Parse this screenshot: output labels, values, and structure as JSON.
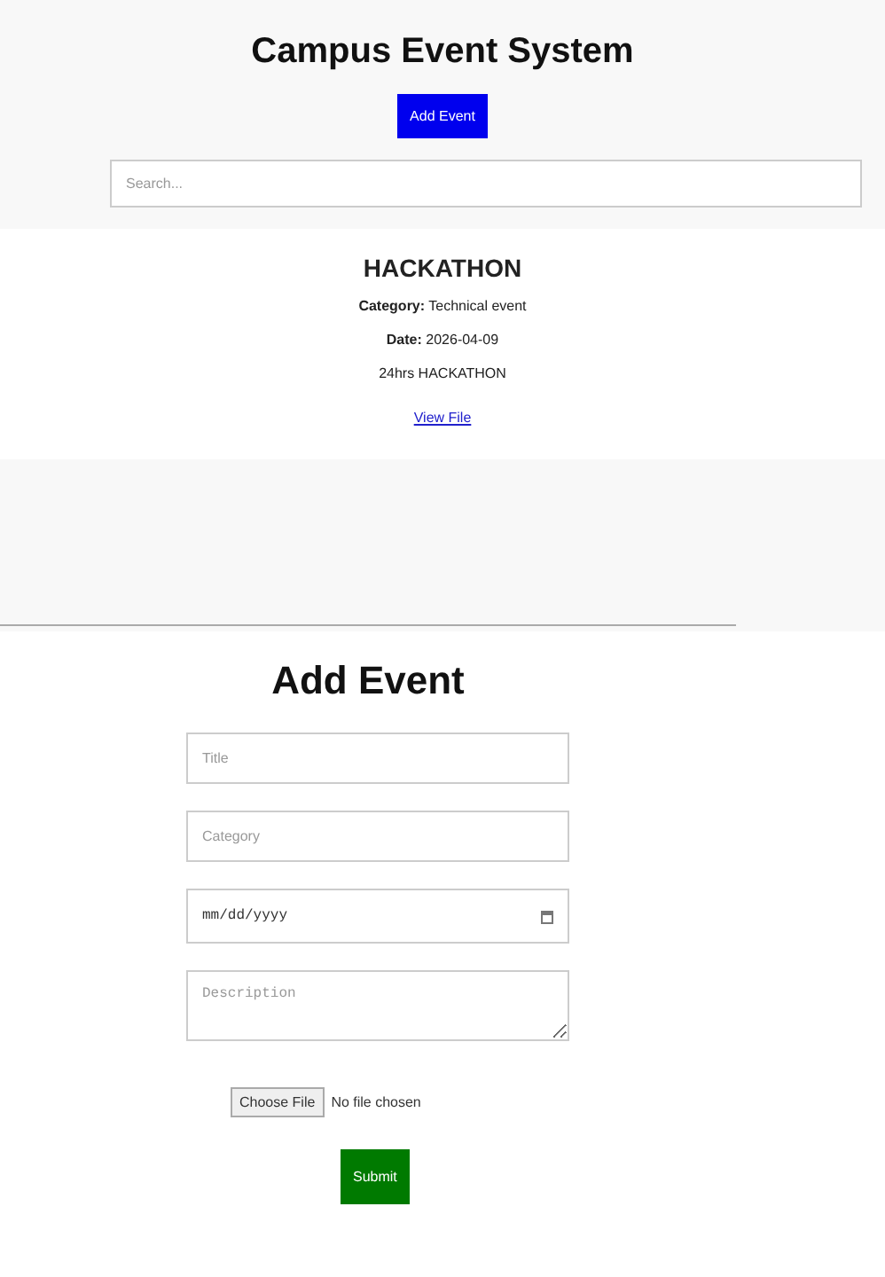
{
  "header": {
    "title": "Campus Event System",
    "add_button": "Add Event",
    "search": {
      "placeholder": "Search..."
    }
  },
  "events": [
    {
      "title": "HACKATHON",
      "category_label": "Category:",
      "category": "Technical event",
      "date_label": "Date:",
      "date": "2026-04-09",
      "description": "24hrs HACKATHON",
      "link": "View File"
    }
  ],
  "form": {
    "title": "Add Event",
    "fields": [
      {
        "kind": "text",
        "placeholder": "Title"
      },
      {
        "kind": "text",
        "placeholder": "Category"
      },
      {
        "kind": "date",
        "placeholder": "mm/dd/yyyy"
      },
      {
        "kind": "textarea",
        "placeholder": "Description"
      }
    ],
    "file": {
      "button": "Choose File",
      "status": "No file chosen"
    },
    "submit": "Submit"
  }
}
